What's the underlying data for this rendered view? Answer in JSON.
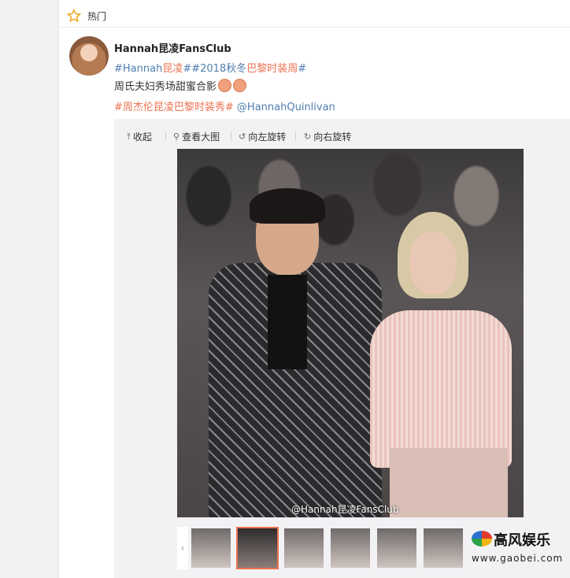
{
  "hot": {
    "label": "热门"
  },
  "post": {
    "username": "Hannah昆凌FansClub",
    "line1": {
      "t1": "#Hannah",
      "t2": "昆凌",
      "t3": "##2018秋冬",
      "t4": "巴黎时装周",
      "t5": "#"
    },
    "line2": "周氏夫妇秀场甜蜜合影",
    "line3": {
      "t1": "#周杰伦昆凌巴黎时装秀#",
      "t2": " @HannahQuinlivan"
    }
  },
  "toolbar": {
    "collapse": "收起",
    "view_large": "查看大图",
    "rotate_left": "向左旋转",
    "rotate_right": "向右旋转"
  },
  "photo": {
    "watermark": "@Hannah昆凌FansClub"
  },
  "logo": {
    "name": "高风娱乐",
    "url": "www.gaobei.com"
  }
}
